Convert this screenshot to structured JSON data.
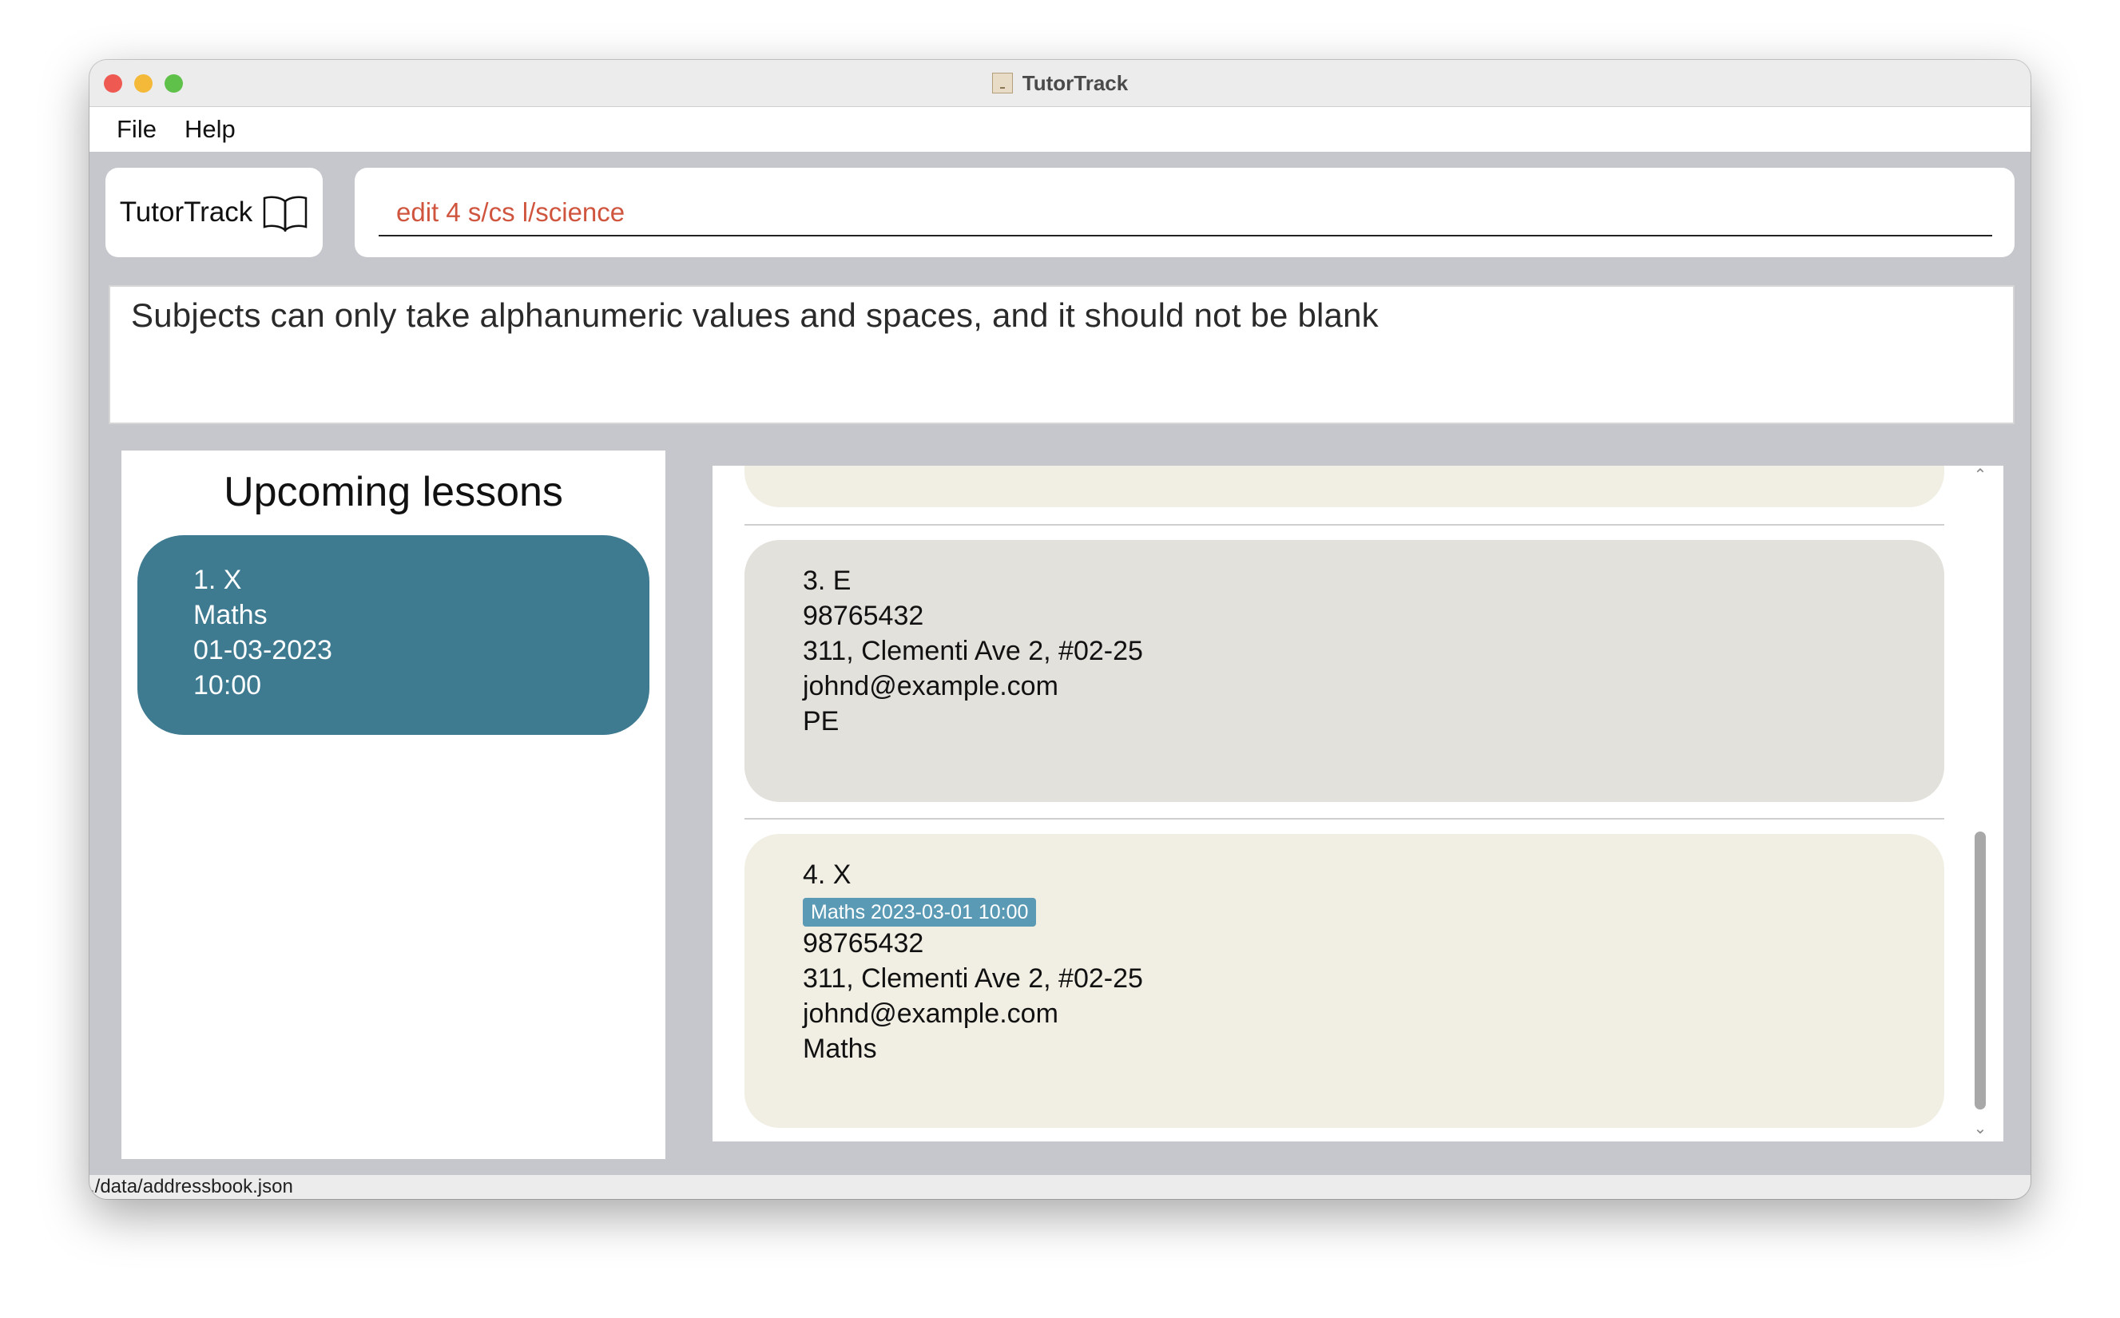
{
  "window": {
    "title": "TutorTrack"
  },
  "menu": {
    "file": "File",
    "help": "Help"
  },
  "brand": {
    "name": "TutorTrack"
  },
  "command": {
    "value": "edit 4 s/cs l/science"
  },
  "result": {
    "message": "Subjects can only take alphanumeric values and spaces, and it should not be blank"
  },
  "lessons": {
    "title": "Upcoming lessons",
    "items": [
      {
        "index": "1.  X",
        "subject": "Maths",
        "date": "01-03-2023",
        "time": "10:00"
      }
    ]
  },
  "persons": [
    {
      "index": "3.  E",
      "phone": "98765432",
      "address": "311, Clementi Ave 2, #02-25",
      "email": "johnd@example.com",
      "subject": "PE"
    },
    {
      "index": "4.  X",
      "tag": "Maths 2023-03-01 10:00",
      "phone": "98765432",
      "address": "311, Clementi Ave 2, #02-25",
      "email": "johnd@example.com",
      "subject": "Maths"
    }
  ],
  "status": {
    "path": "./data/addressbook.json"
  },
  "colors": {
    "lesson_card": "#3e7a90",
    "command_text": "#d0553f",
    "tag": "#5b9ab4",
    "card_beige": "#f1eee3",
    "card_gray": "#e3e1dc"
  }
}
